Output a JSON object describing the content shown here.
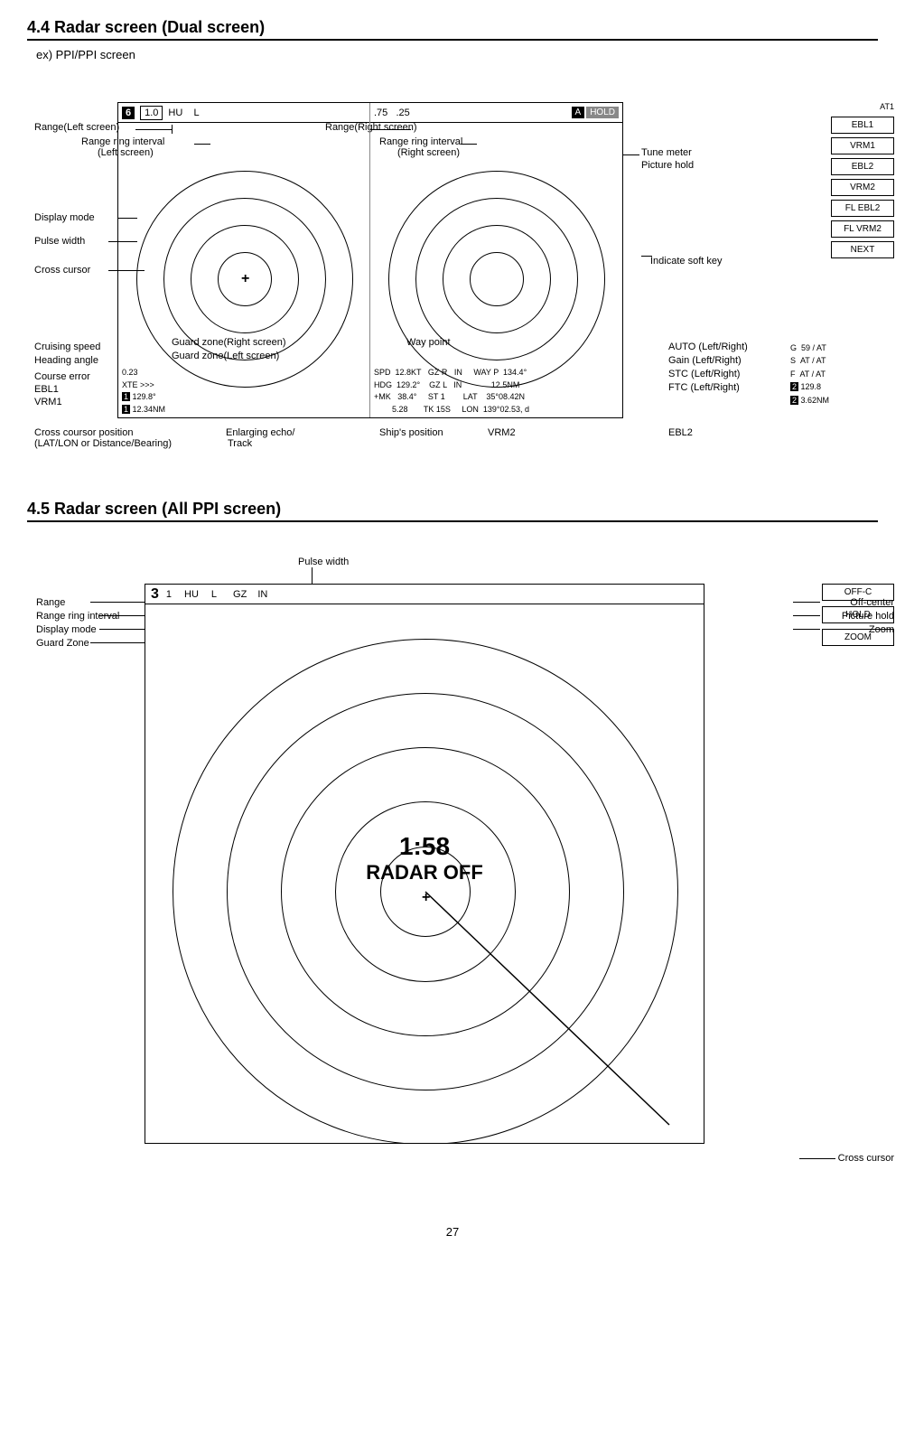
{
  "section44": {
    "title": "4.4 Radar screen (Dual screen)",
    "subtitle": "ex) PPI/PPI screen",
    "labels": {
      "range_left": "Range(Left screen)",
      "range_right": "Range(Right screen)",
      "range_ring_left": "Range ring interval",
      "range_ring_left2": "(Left screen)",
      "range_ring_right": "Range ring interval",
      "range_ring_right2": "(Right screen)",
      "display_mode": "Display mode",
      "pulse_width": "Pulse width",
      "cross_cursor": "Cross cursor",
      "cruising_speed": "Cruising speed",
      "heading_angle": "Heading angle",
      "guard_zone_right": "Guard zone(Right screen)",
      "guard_zone_left": "Guard zone(Left screen)",
      "way_point": "Way point",
      "course_error": "Course error",
      "ebl1_label": "EBL1",
      "vrm1_label": "VRM1",
      "cross_cursor_pos": "Cross coursor position",
      "latlon": "(LAT/LON or Distance/Bearing)",
      "enlarging_echo": "Enlarging echo/",
      "track": "Track",
      "ships_position": "Ship's position",
      "vrm2_label": "VRM2",
      "ebl2_label": "EBL2",
      "tune_meter": "Tune meter",
      "picture_hold": "Picture hold",
      "indicate_soft_key": "Indicate soft key",
      "auto_lr": "AUTO (Left/Right)",
      "gain_lr": "Gain (Left/Right)",
      "stc_lr": "STC (Left/Right)",
      "ftc_lr": "FTC (Left/Right)",
      "ebl2_right": "EBL2"
    },
    "screen_header_left": {
      "box": "6",
      "white": "1.0",
      "text": "HU    L"
    },
    "screen_header_right": {
      "text": ".75   .25",
      "hold_label": "HOLD"
    },
    "soft_keys": [
      "EBL1",
      "VRM1",
      "EBL2",
      "VRM2",
      "FL EBL2",
      "FL VRM2",
      "NEXT"
    ],
    "data_rows": {
      "row1": "0.23          SPD  12.8KT     GZ R   IN       WAY P  134.4°",
      "row2": "XTE >>>        HDG  129.2°     GZ L   IN              12.5NM",
      "row3": "1  129.8°      +MK   38.4°     ST 1           LAT   35°08.42N",
      "row4": "1  12.34NM          5.28       TK 15S         LON  139°02.53",
      "at_row": "AT1",
      "g_row": "G  59 / AT",
      "s_row": "S  AT / AT",
      "f_row": "F  AT / AT",
      "z_row": "2  129.8",
      "z2_row": "2  3.62NM"
    }
  },
  "section45": {
    "title": "4.5 Radar screen (All PPI screen)",
    "labels": {
      "pulse_width": "Pulse width",
      "range": "Range",
      "range_ring": "Range ring interval",
      "display_mode": "Display mode",
      "guard_zone": "Guard Zone",
      "off_center": "Off-center",
      "picture_hold": "Picture hold",
      "zoom": "Zoom",
      "cross_cursor": "Cross cursor"
    },
    "screen_header": {
      "num": "3",
      "num2": "1",
      "hu": "HU",
      "l": "L",
      "gz": "GZ",
      "in_": "IN"
    },
    "right_panel": [
      "OFF-C",
      "HOLD",
      "ZOOM"
    ],
    "radar_time": "1:58",
    "radar_off": "RADAR OFF"
  },
  "page_number": "27"
}
